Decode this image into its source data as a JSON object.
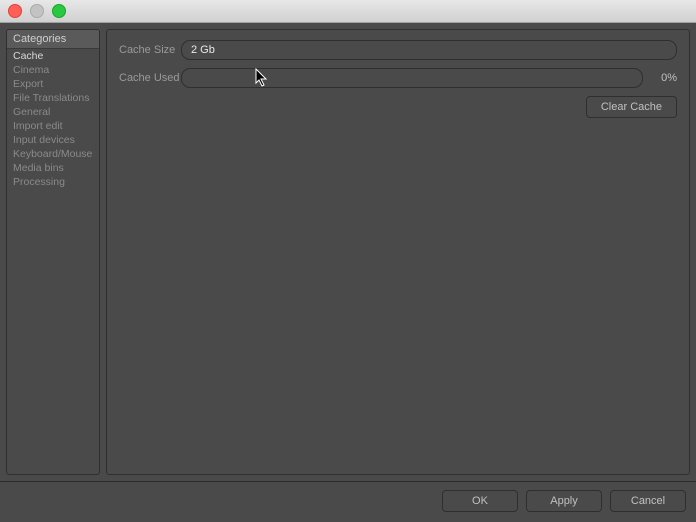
{
  "titlebar": {
    "title": ""
  },
  "sidebar": {
    "header": "Categories",
    "items": [
      "Cache",
      "Cinema",
      "Export",
      "File Translations",
      "General",
      "Import edit",
      "Input devices",
      "Keyboard/Mouse",
      "Media bins",
      "Processing"
    ],
    "selected_index": 0
  },
  "main": {
    "cache_size_label": "Cache Size",
    "cache_size_value": "2 Gb",
    "cache_used_label": "Cache Used",
    "cache_used_percent": "0%",
    "clear_cache_button": "Clear Cache"
  },
  "footer": {
    "ok": "OK",
    "apply": "Apply",
    "cancel": "Cancel"
  }
}
